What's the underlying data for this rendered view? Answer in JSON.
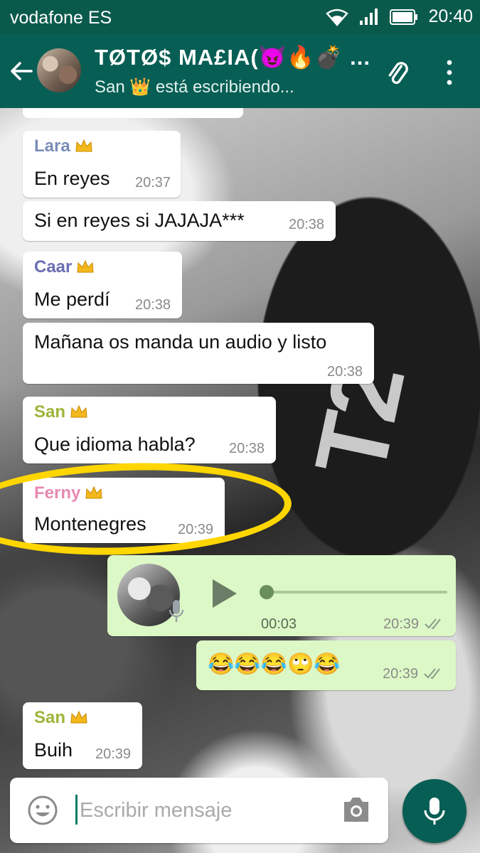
{
  "status_bar": {
    "carrier": "vodafone ES",
    "time": "20:40"
  },
  "header": {
    "title": "TØTØ$ MA£IA(😈🔥💣 ...",
    "subtitle": "San 👑 está escribiendo..."
  },
  "messages": [
    {
      "sender": "Lara",
      "sender_color": "#7a8db8",
      "text": "En reyes",
      "time": "20:37"
    },
    {
      "text": "Si en reyes si JAJAJA***",
      "time": "20:38"
    },
    {
      "sender": "Caar",
      "sender_color": "#6b6eb3",
      "text": "Me perdí",
      "time": "20:38"
    },
    {
      "text": "Mañana os manda un audio y listo",
      "time": "20:38"
    },
    {
      "sender": "San",
      "sender_color": "#9cb53a",
      "text": "Que idioma habla?",
      "time": "20:38"
    },
    {
      "sender": "Ferny",
      "sender_color": "#e88ab0",
      "text": "Montenegres",
      "time": "20:39"
    },
    {
      "type": "audio",
      "duration": "00:03",
      "time": "20:39"
    },
    {
      "text": "😂😂😂🙄😂",
      "time": "20:39"
    },
    {
      "sender": "San",
      "sender_color": "#9cb53a",
      "text": "Buih",
      "time": "20:39"
    }
  ],
  "composer": {
    "placeholder": "Escribir mensaje"
  },
  "colors": {
    "header": "#075e54",
    "outgoing": "#dcf8c6",
    "highlight": "#ffd600"
  }
}
